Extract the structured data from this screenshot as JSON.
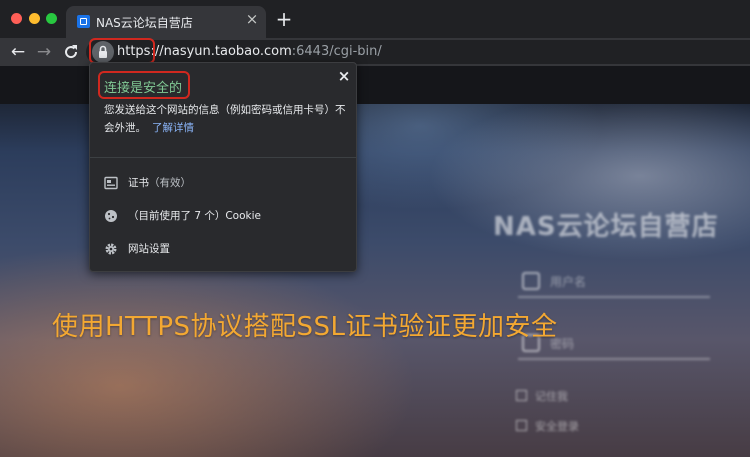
{
  "browser": {
    "tab": {
      "title": "NAS云论坛自营店",
      "favicon": "site-favicon-icon",
      "close": "×"
    },
    "new_tab": "+",
    "nav": {
      "back": "←",
      "forward": "→",
      "reload": "⟳"
    },
    "url": {
      "scheme": "https://",
      "host": "nasyun.taobao.com",
      "rest": ":6443/cgi-bin/"
    }
  },
  "popup": {
    "close": "×",
    "title": "连接是安全的",
    "description": "您发送给这个网站的信息（例如密码或信用卡号）不会外泄。",
    "learn_more": "了解详情",
    "items": [
      {
        "icon": "certificate-icon",
        "label": "证书",
        "sub": "（有效）"
      },
      {
        "icon": "cookie-icon",
        "label": "（目前使用了 7 个）Cookie",
        "sub": ""
      },
      {
        "icon": "gear-icon",
        "label": "网站设置",
        "sub": ""
      }
    ]
  },
  "page": {
    "store_title": "NAS云论坛自营店",
    "username_placeholder": "用户名",
    "password_placeholder": "密码",
    "remember": "记住我",
    "secure_login": "安全登录",
    "promo": "使用HTTPS协议搭配SSL证书验证更加安全"
  },
  "colors": {
    "secure_green": "#81c995",
    "highlight_red": "#d0281f",
    "promo_orange": "#f3a832",
    "link_blue": "#8ab4f8"
  }
}
